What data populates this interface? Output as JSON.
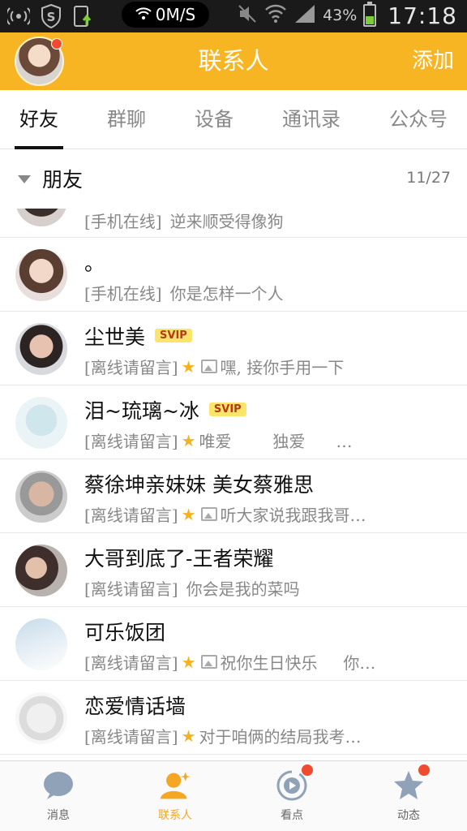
{
  "status_bar": {
    "speed": "0M/S",
    "battery": "43%",
    "battery_level": 0.43,
    "time": "17:18",
    "icons": [
      "hotspot-icon",
      "shield-s-icon",
      "download-icon",
      "wifi-icon",
      "mute-icon",
      "signal-icon",
      "battery-icon"
    ]
  },
  "header": {
    "title": "联系人",
    "add_label": "添加",
    "has_notification": true
  },
  "tabs": [
    {
      "label": "好友",
      "active": true
    },
    {
      "label": "群聊",
      "active": false
    },
    {
      "label": "设备",
      "active": false
    },
    {
      "label": "通讯录",
      "active": false
    },
    {
      "label": "公众号",
      "active": false
    }
  ],
  "group": {
    "name": "朋友",
    "count": "11/27"
  },
  "contacts": [
    {
      "name": "",
      "status": "[手机在线]",
      "message": "逆来顺受得像狗",
      "svip": false,
      "star": false,
      "image": false
    },
    {
      "name": "。",
      "status": "[手机在线]",
      "message": "你是怎样一个人",
      "svip": false,
      "star": false,
      "image": false
    },
    {
      "name": "尘世美",
      "status": "[离线请留言]",
      "message": "嘿, 接你手用一下",
      "svip": true,
      "star": true,
      "image": true
    },
    {
      "name": "泪~琉璃~冰",
      "status": "[离线请留言]",
      "message": "唯爱        独爱      …",
      "svip": true,
      "star": true,
      "image": false
    },
    {
      "name": "蔡徐坤亲妹妹 美女蔡雅思",
      "status": "[离线请留言]",
      "message": "听大家说我跟我哥…",
      "svip": false,
      "star": true,
      "image": true
    },
    {
      "name": "大哥到底了-王者荣耀",
      "status": "[离线请留言]",
      "message": "你会是我的菜吗",
      "svip": false,
      "star": false,
      "image": false
    },
    {
      "name": "可乐饭团",
      "status": "[离线请留言]",
      "message": "祝你生日快乐     你…",
      "svip": false,
      "star": true,
      "image": true
    },
    {
      "name": "恋爱情话墙",
      "status": "[离线请留言]",
      "message": "对于咱俩的结局我考…",
      "svip": false,
      "star": true,
      "image": false
    }
  ],
  "svip_label": "SVIP",
  "star_glyph": "★",
  "bottom_nav": [
    {
      "label": "消息",
      "icon": "message-icon",
      "active": false,
      "dot": false
    },
    {
      "label": "联系人",
      "icon": "contacts-icon",
      "active": true,
      "dot": false
    },
    {
      "label": "看点",
      "icon": "play-icon",
      "active": false,
      "dot": true
    },
    {
      "label": "动态",
      "icon": "star-icon",
      "active": false,
      "dot": true
    }
  ],
  "colors": {
    "accent": "#f7b523",
    "badge": "#f04b2e",
    "svip_bg": "#fbe46a"
  }
}
